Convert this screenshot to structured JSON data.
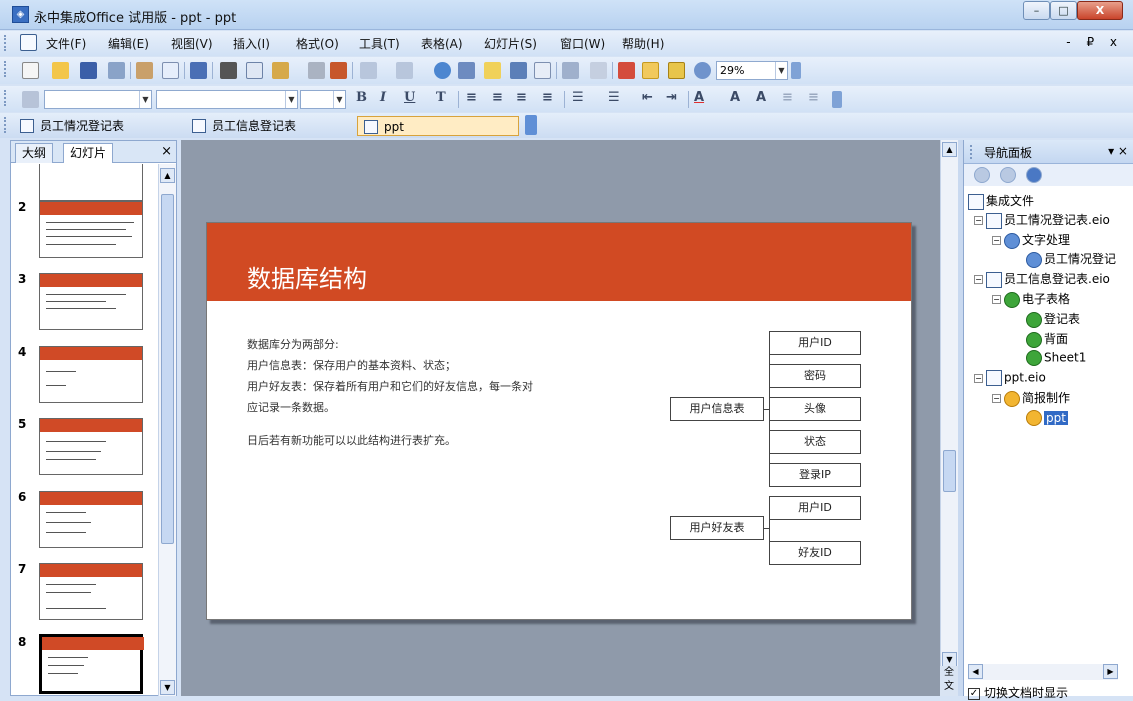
{
  "window": {
    "title": "永中集成Office 试用版 - ppt - ppt",
    "min": "–",
    "max": "□",
    "close": "X"
  },
  "menubar": {
    "items": [
      "文件(F)",
      "编辑(E)",
      "视图(V)",
      "插入(I)",
      "格式(O)",
      "工具(T)",
      "表格(A)",
      "幻灯片(S)",
      "窗口(W)",
      "帮助(H)"
    ],
    "mdi_controls": "- ₽ x"
  },
  "toolbar1": {
    "zoom": "29%"
  },
  "doc_tabs": [
    "员工情况登记表",
    "员工信息登记表",
    "ppt"
  ],
  "left_pane": {
    "tabs": [
      "大纲",
      "幻灯片"
    ],
    "close": "×",
    "slide_numbers": [
      "2",
      "3",
      "4",
      "5",
      "6",
      "7",
      "8"
    ]
  },
  "slide": {
    "title": "数据库结构",
    "lines": [
      "数据库分为两部分:",
      "用户信息表：保存用户的基本资料、状态；",
      "用户好友表：保存着所有用户和它们的好友信息，每一条对",
      "应记录一条数据。",
      "日后若有新功能可以以此结构进行表扩充。"
    ],
    "diagram": {
      "table1": "用户信息表",
      "table1_fields": [
        "用户ID",
        "密码",
        "头像",
        "状态",
        "登录IP"
      ],
      "table2": "用户好友表",
      "table2_fields": [
        "用户ID",
        "好友ID"
      ]
    }
  },
  "nav_pane": {
    "title": "导航面板",
    "controls": "▾ ×",
    "tree": {
      "root": "集成文件",
      "file1": "员工情况登记表.eio",
      "file1_cat": "文字处理",
      "file1_doc": "员工情况登记",
      "file2": "员工信息登记表.eio",
      "file2_cat": "电子表格",
      "file2_docs": [
        "登记表",
        "背面",
        "Sheet1"
      ],
      "file3": "ppt.eio",
      "file3_cat": "简报制作",
      "file3_doc": "ppt"
    },
    "checkbox": "切换文档时显示"
  },
  "editor_bottom": "全 文"
}
